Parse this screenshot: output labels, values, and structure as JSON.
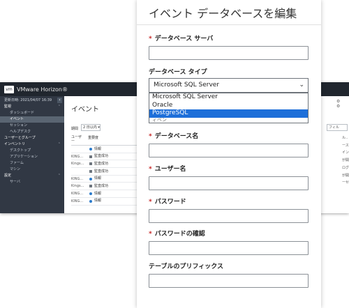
{
  "console": {
    "logo": "vm",
    "title": "VMware Horizon®",
    "updated": "更新日時: 2021/04/07 16:39",
    "collapse_glyph": "‹",
    "nav": [
      {
        "label": "監視",
        "type": "section",
        "chevron": true
      },
      {
        "label": "ダッシュボード",
        "type": "child"
      },
      {
        "label": "イベント",
        "type": "child",
        "active": true
      },
      {
        "label": "セッション",
        "type": "child"
      },
      {
        "label": "ヘルプデスク",
        "type": "child"
      },
      {
        "label": "ユーザーとグループ",
        "type": "section"
      },
      {
        "label": "インベントリ",
        "type": "section",
        "chevron": true
      },
      {
        "label": "デスクトップ",
        "type": "child"
      },
      {
        "label": "アプリケーション",
        "type": "child"
      },
      {
        "label": "ファーム",
        "type": "child"
      },
      {
        "label": "マシン",
        "type": "child"
      },
      {
        "label": "設定",
        "type": "section",
        "chevron": true
      },
      {
        "label": "サーバ",
        "type": "child"
      }
    ],
    "page_title": "イベント",
    "period_label": "期間",
    "period_value": "2 日以内 ▾",
    "table_headers": {
      "user": "ユーザ ー",
      "severity": "重要度"
    },
    "rows": [
      {
        "user": "",
        "severity": "情報",
        "kind": "info"
      },
      {
        "user": "KING...",
        "severity": "監査成功",
        "kind": "audit"
      },
      {
        "user": "Kings...",
        "severity": "監査成功",
        "kind": "audit"
      },
      {
        "user": "",
        "severity": "監査成功",
        "kind": "audit"
      },
      {
        "user": "KING...",
        "severity": "情報",
        "kind": "info"
      },
      {
        "user": "Kings...",
        "severity": "監査成功",
        "kind": "audit"
      },
      {
        "user": "KING...",
        "severity": "情報",
        "kind": "info"
      },
      {
        "user": "KING...",
        "severity": "情報",
        "kind": "info"
      }
    ],
    "right": {
      "icons": "⚙ ⚙",
      "filter": "フィル",
      "lines": [
        "ル..",
        "ース",
        "インしま",
        "が開始しま",
        "ログオフし",
        "が開始しま",
        "ーセッショ"
      ]
    }
  },
  "modal": {
    "title": "イベント データベースを編集",
    "required_mark": "*",
    "fields": {
      "server": {
        "label": "データベース サーバ",
        "value": ""
      },
      "db_type": {
        "label": "データベース タイプ",
        "selected": "Microsoft SQL Server"
      },
      "db_name": {
        "label": "データベース名",
        "value": ""
      },
      "user": {
        "label": "ユーザー名",
        "value": ""
      },
      "password": {
        "label": "パスワード",
        "value": ""
      },
      "password_confirm": {
        "label": "パスワードの確認",
        "value": ""
      },
      "table_prefix": {
        "label": "テーブルのプリフィックス",
        "value": ""
      }
    },
    "dropdown_options": [
      "Microsoft SQL Server",
      "Oracle",
      "PostgreSQL"
    ],
    "highlighted_option": "PostgreSQL",
    "dropdown_cut_text": "ィベン",
    "select_caret": "⌄"
  },
  "colors": {
    "console_header": "#20262e",
    "sidebar": "#313844",
    "required": "#c62828",
    "option_highlight": "#1e6fd9",
    "info_icon": "#2c7bcb"
  }
}
